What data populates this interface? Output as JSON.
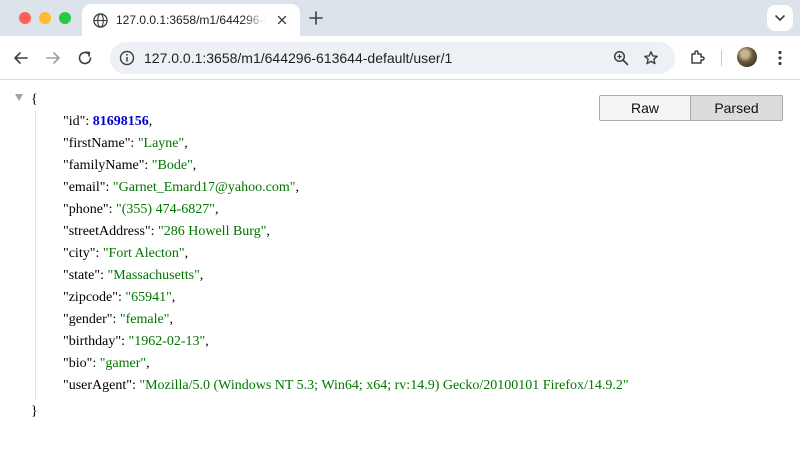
{
  "browser": {
    "tab": {
      "title": "127.0.0.1:3658/m1/644296-613644-default/user/1"
    },
    "url": "127.0.0.1:3658/m1/644296-613644-default/user/1"
  },
  "viewer": {
    "raw_label": "Raw",
    "parsed_label": "Parsed",
    "open_brace": "{",
    "close_brace": "}",
    "active_mode": "Parsed"
  },
  "json": {
    "properties": [
      {
        "key": "\"id\"",
        "value": "81698156",
        "type": "number"
      },
      {
        "key": "\"firstName\"",
        "value": "\"Layne\"",
        "type": "string"
      },
      {
        "key": "\"familyName\"",
        "value": "\"Bode\"",
        "type": "string"
      },
      {
        "key": "\"email\"",
        "value": "\"Garnet_Emard17@yahoo.com\"",
        "type": "string"
      },
      {
        "key": "\"phone\"",
        "value": "\"(355) 474-6827\"",
        "type": "string"
      },
      {
        "key": "\"streetAddress\"",
        "value": "\"286 Howell Burg\"",
        "type": "string"
      },
      {
        "key": "\"city\"",
        "value": "\"Fort Alecton\"",
        "type": "string"
      },
      {
        "key": "\"state\"",
        "value": "\"Massachusetts\"",
        "type": "string"
      },
      {
        "key": "\"zipcode\"",
        "value": "\"65941\"",
        "type": "string"
      },
      {
        "key": "\"gender\"",
        "value": "\"female\"",
        "type": "string"
      },
      {
        "key": "\"birthday\"",
        "value": "\"1962-02-13\"",
        "type": "string"
      },
      {
        "key": "\"bio\"",
        "value": "\"gamer\"",
        "type": "string"
      },
      {
        "key": "\"userAgent\"",
        "value": "\"Mozilla/5.0 (Windows NT 5.3; Win64; x64; rv:14.9) Gecko/20100101 Firefox/14.9.2\"",
        "type": "string"
      }
    ]
  },
  "colors": {
    "string": "#007500",
    "number": "#0000d0",
    "tabstrip": "#dde3ea",
    "omnibox": "#edf1f6"
  },
  "icons": {
    "tab": [
      "globe-icon",
      "close-icon"
    ],
    "toolbar": [
      "back-arrow-icon",
      "forward-arrow-icon",
      "reload-icon",
      "site-info-icon",
      "zoom-icon",
      "bookmark-star-icon",
      "extensions-icon",
      "avatar",
      "kebab-menu-icon"
    ]
  }
}
